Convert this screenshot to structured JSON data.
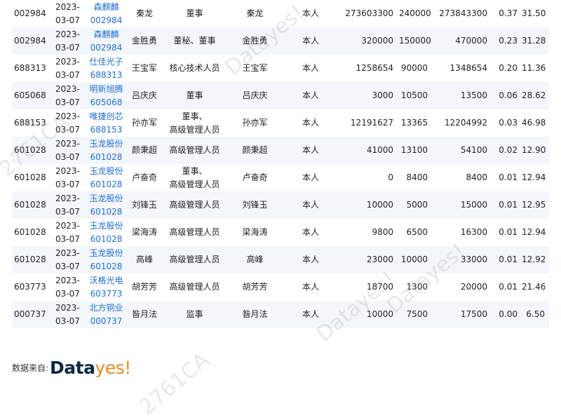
{
  "rows": [
    {
      "code": "002984",
      "date": [
        "2023-",
        "03-07"
      ],
      "stock": [
        "森麒麟",
        "002984"
      ],
      "person": "秦龙",
      "position": [
        "董事"
      ],
      "relation_person": "秦龙",
      "relation": "本人",
      "before": "273603300",
      "change": "240000",
      "after": "273843300",
      "pct": "0.37",
      "price": "31.50"
    },
    {
      "code": "002984",
      "date": [
        "2023-",
        "03-07"
      ],
      "stock": [
        "森麒麟",
        "002984"
      ],
      "person": "金胜勇",
      "position": [
        "董秘、董事"
      ],
      "relation_person": "金胜勇",
      "relation": "本人",
      "before": "320000",
      "change": "150000",
      "after": "470000",
      "pct": "0.23",
      "price": "31.28"
    },
    {
      "code": "688313",
      "date": [
        "2023-",
        "03-07"
      ],
      "stock": [
        "仕佳光子",
        "688313"
      ],
      "person": "王宝军",
      "position": [
        "核心技术人员"
      ],
      "relation_person": "王宝军",
      "relation": "本人",
      "before": "1258654",
      "change": "90000",
      "after": "1348654",
      "pct": "0.20",
      "price": "11.36"
    },
    {
      "code": "605068",
      "date": [
        "2023-",
        "03-07"
      ],
      "stock": [
        "明新旭腾",
        "605068"
      ],
      "person": "吕庆庆",
      "position": [
        "董事"
      ],
      "relation_person": "吕庆庆",
      "relation": "本人",
      "before": "3000",
      "change": "10500",
      "after": "13500",
      "pct": "0.06",
      "price": "28.62"
    },
    {
      "code": "688153",
      "date": [
        "2023-",
        "03-07"
      ],
      "stock": [
        "唯捷创芯",
        "688153"
      ],
      "person": "孙亦军",
      "position": [
        "董事、",
        "高级管理人员"
      ],
      "relation_person": "孙亦军",
      "relation": "本人",
      "before": "12191627",
      "change": "13365",
      "after": "12204992",
      "pct": "0.03",
      "price": "46.98"
    },
    {
      "code": "601028",
      "date": [
        "2023-",
        "03-07"
      ],
      "stock": [
        "玉龙股份",
        "601028"
      ],
      "person": "颜秉超",
      "position": [
        "高级管理人员"
      ],
      "relation_person": "颜秉超",
      "relation": "本人",
      "before": "41000",
      "change": "13100",
      "after": "54100",
      "pct": "0.02",
      "price": "12.90"
    },
    {
      "code": "601028",
      "date": [
        "2023-",
        "03-07"
      ],
      "stock": [
        "玉龙股份",
        "601028"
      ],
      "person": "卢奋奇",
      "position": [
        "董事、",
        "高级管理人员"
      ],
      "relation_person": "卢奋奇",
      "relation": "本人",
      "before": "0",
      "change": "8400",
      "after": "8400",
      "pct": "0.01",
      "price": "12.94"
    },
    {
      "code": "601028",
      "date": [
        "2023-",
        "03-07"
      ],
      "stock": [
        "玉龙股份",
        "601028"
      ],
      "person": "刘锋玉",
      "position": [
        "高级管理人员"
      ],
      "relation_person": "刘锋玉",
      "relation": "本人",
      "before": "10000",
      "change": "5000",
      "after": "15000",
      "pct": "0.01",
      "price": "12.95"
    },
    {
      "code": "601028",
      "date": [
        "2023-",
        "03-07"
      ],
      "stock": [
        "玉龙股份",
        "601028"
      ],
      "person": "梁海涛",
      "position": [
        "高级管理人员"
      ],
      "relation_person": "梁海涛",
      "relation": "本人",
      "before": "9800",
      "change": "6500",
      "after": "16300",
      "pct": "0.01",
      "price": "12.94"
    },
    {
      "code": "601028",
      "date": [
        "2023-",
        "03-07"
      ],
      "stock": [
        "玉龙股份",
        "601028"
      ],
      "person": "高峰",
      "position": [
        "高级管理人员"
      ],
      "relation_person": "高峰",
      "relation": "本人",
      "before": "23000",
      "change": "10000",
      "after": "33000",
      "pct": "0.01",
      "price": "12.92"
    },
    {
      "code": "603773",
      "date": [
        "2023-",
        "03-07"
      ],
      "stock": [
        "沃格光电",
        "603773"
      ],
      "person": "胡芳芳",
      "position": [
        "高级管理人员"
      ],
      "relation_person": "胡芳芳",
      "relation": "本人",
      "before": "18700",
      "change": "1300",
      "after": "20000",
      "pct": "0.01",
      "price": "21.46"
    },
    {
      "code": "000737",
      "date": [
        "2023-",
        "03-07"
      ],
      "stock": [
        "北方铜业",
        "000737"
      ],
      "person": "昝月法",
      "position": [
        "监事"
      ],
      "relation_person": "昝月法",
      "relation": "本人",
      "before": "10000",
      "change": "7500",
      "after": "17500",
      "pct": "0.00",
      "price": "6.50"
    }
  ],
  "footer": {
    "label": "数据来自:",
    "logo_part1": "Data",
    "logo_part2": "yes!"
  },
  "watermarks": [
    "Datayes!",
    "Datayes!",
    "Datayes!",
    "2761CA",
    "2761CA"
  ],
  "colors": {
    "link": "#1e6fd6",
    "row_alt": "#f3f6fb",
    "logo_dark": "#0b2a4a",
    "logo_orange": "#f08a1d"
  }
}
